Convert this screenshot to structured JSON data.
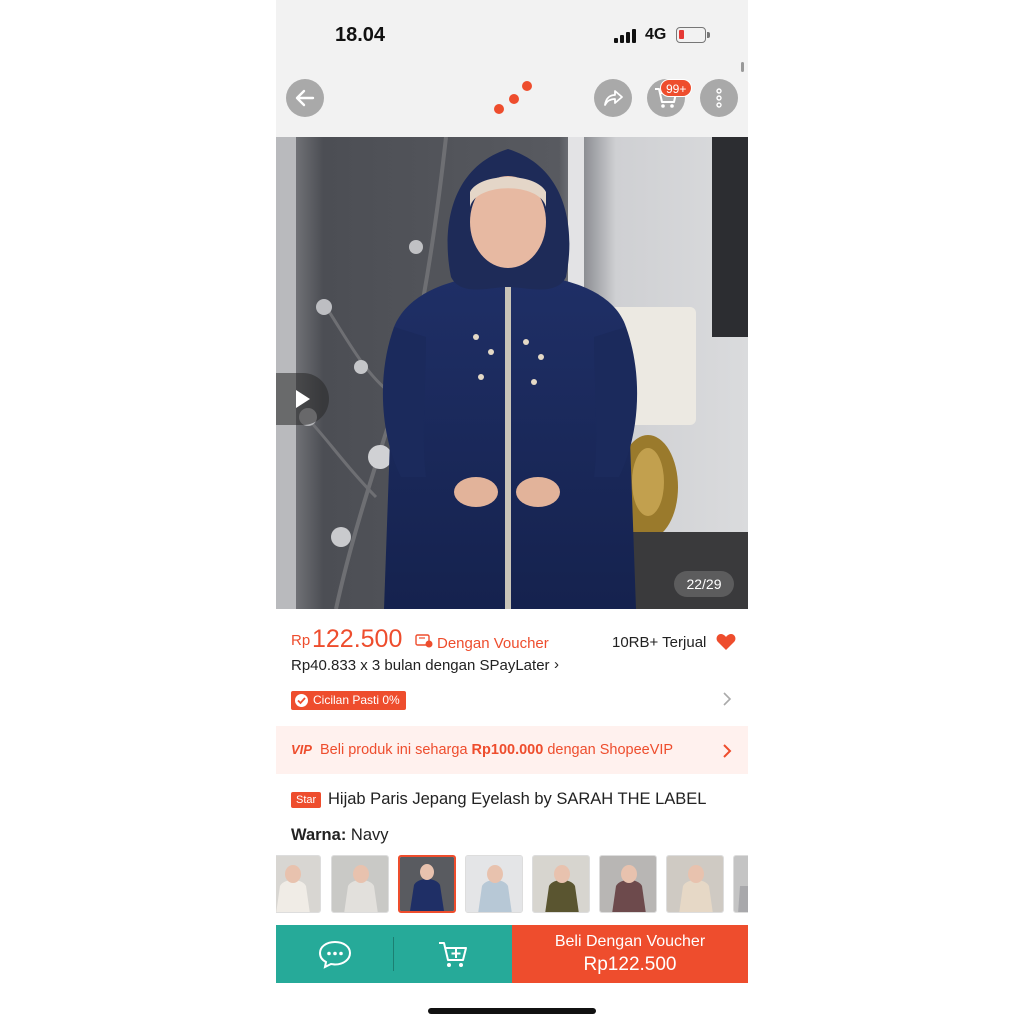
{
  "status_bar": {
    "time": "18.04",
    "network": "4G",
    "battery_color": "#e53935"
  },
  "header": {
    "cart_badge": "99+"
  },
  "gallery": {
    "counter": "22/29"
  },
  "price": {
    "currency": "Rp",
    "amount": "122.500",
    "voucher_label": "Dengan Voucher",
    "sold": "10RB+ Terjual",
    "installment": "Rp40.833 x 3 bulan dengan SPayLater",
    "installment_chevron": "›",
    "cicilan_badge": "Cicilan Pasti 0%"
  },
  "vip_banner": {
    "tag": "VIP",
    "text_before": "Beli produk ini seharga ",
    "text_bold": "Rp100.000",
    "text_after": " dengan ShopeeVIP"
  },
  "product": {
    "badge": "Star",
    "title": "Hijab Paris Jepang Eyelash by SARAH THE LABEL"
  },
  "variant": {
    "label": "Warna:",
    "value": " Navy",
    "thumbnails": [
      {
        "name": "white",
        "selected": false
      },
      {
        "name": "grey",
        "selected": false
      },
      {
        "name": "navy",
        "selected": true
      },
      {
        "name": "light-blue",
        "selected": false
      },
      {
        "name": "olive",
        "selected": false
      },
      {
        "name": "mauve",
        "selected": false
      },
      {
        "name": "cream",
        "selected": false
      },
      {
        "name": "silver",
        "selected": false
      }
    ]
  },
  "bottom_bar": {
    "buy_line1": "Beli Dengan Voucher",
    "buy_line2": "Rp122.500"
  },
  "colors": {
    "brand": "#ee4d2d",
    "chat": "#26aa99"
  },
  "icons": [
    "back-arrow-icon",
    "share-icon",
    "cart-icon",
    "more-icon",
    "play-icon",
    "voucher-icon",
    "heart-icon",
    "check-icon",
    "chevron-right-icon",
    "chat-icon",
    "add-to-cart-icon"
  ]
}
